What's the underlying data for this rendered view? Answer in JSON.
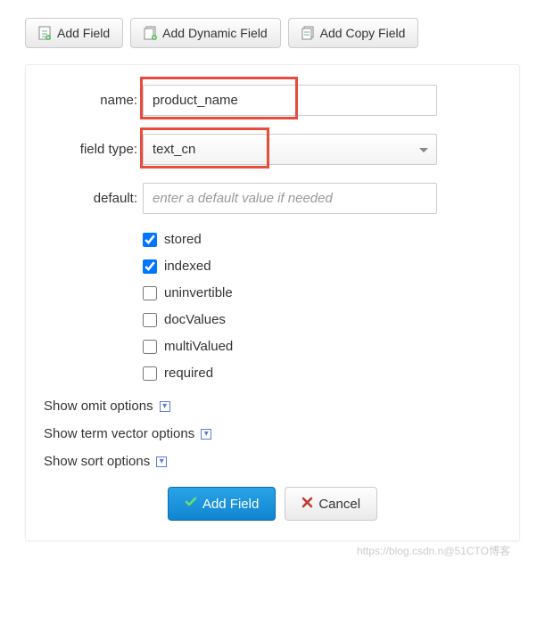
{
  "top_buttons": {
    "add_field": "Add Field",
    "add_dynamic_field": "Add Dynamic Field",
    "add_copy_field": "Add Copy Field"
  },
  "form": {
    "name_label": "name:",
    "name_value": "product_name",
    "field_type_label": "field type:",
    "field_type_value": "text_cn",
    "default_label": "default:",
    "default_placeholder": "enter a default value if needed",
    "checkboxes": {
      "stored": "stored",
      "indexed": "indexed",
      "uninvertible": "uninvertible",
      "docValues": "docValues",
      "multiValued": "multiValued",
      "required": "required"
    },
    "expanders": {
      "omit": "Show omit options",
      "term_vector": "Show term vector options",
      "sort": "Show sort options"
    }
  },
  "actions": {
    "add_field": "Add Field",
    "cancel": "Cancel"
  },
  "watermark": "https://blog.csdn.n@51CTO博客"
}
